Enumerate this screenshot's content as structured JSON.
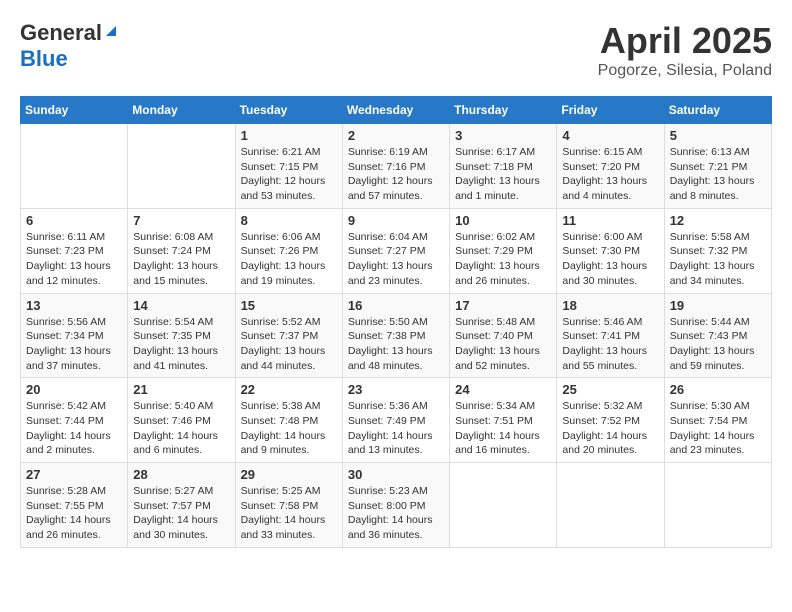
{
  "header": {
    "logo_general": "General",
    "logo_blue": "Blue",
    "title": "April 2025",
    "subtitle": "Pogorze, Silesia, Poland"
  },
  "calendar": {
    "days_of_week": [
      "Sunday",
      "Monday",
      "Tuesday",
      "Wednesday",
      "Thursday",
      "Friday",
      "Saturday"
    ],
    "weeks": [
      [
        {
          "day": "",
          "info": ""
        },
        {
          "day": "",
          "info": ""
        },
        {
          "day": "1",
          "info": "Sunrise: 6:21 AM\nSunset: 7:15 PM\nDaylight: 12 hours and 53 minutes."
        },
        {
          "day": "2",
          "info": "Sunrise: 6:19 AM\nSunset: 7:16 PM\nDaylight: 12 hours and 57 minutes."
        },
        {
          "day": "3",
          "info": "Sunrise: 6:17 AM\nSunset: 7:18 PM\nDaylight: 13 hours and 1 minute."
        },
        {
          "day": "4",
          "info": "Sunrise: 6:15 AM\nSunset: 7:20 PM\nDaylight: 13 hours and 4 minutes."
        },
        {
          "day": "5",
          "info": "Sunrise: 6:13 AM\nSunset: 7:21 PM\nDaylight: 13 hours and 8 minutes."
        }
      ],
      [
        {
          "day": "6",
          "info": "Sunrise: 6:11 AM\nSunset: 7:23 PM\nDaylight: 13 hours and 12 minutes."
        },
        {
          "day": "7",
          "info": "Sunrise: 6:08 AM\nSunset: 7:24 PM\nDaylight: 13 hours and 15 minutes."
        },
        {
          "day": "8",
          "info": "Sunrise: 6:06 AM\nSunset: 7:26 PM\nDaylight: 13 hours and 19 minutes."
        },
        {
          "day": "9",
          "info": "Sunrise: 6:04 AM\nSunset: 7:27 PM\nDaylight: 13 hours and 23 minutes."
        },
        {
          "day": "10",
          "info": "Sunrise: 6:02 AM\nSunset: 7:29 PM\nDaylight: 13 hours and 26 minutes."
        },
        {
          "day": "11",
          "info": "Sunrise: 6:00 AM\nSunset: 7:30 PM\nDaylight: 13 hours and 30 minutes."
        },
        {
          "day": "12",
          "info": "Sunrise: 5:58 AM\nSunset: 7:32 PM\nDaylight: 13 hours and 34 minutes."
        }
      ],
      [
        {
          "day": "13",
          "info": "Sunrise: 5:56 AM\nSunset: 7:34 PM\nDaylight: 13 hours and 37 minutes."
        },
        {
          "day": "14",
          "info": "Sunrise: 5:54 AM\nSunset: 7:35 PM\nDaylight: 13 hours and 41 minutes."
        },
        {
          "day": "15",
          "info": "Sunrise: 5:52 AM\nSunset: 7:37 PM\nDaylight: 13 hours and 44 minutes."
        },
        {
          "day": "16",
          "info": "Sunrise: 5:50 AM\nSunset: 7:38 PM\nDaylight: 13 hours and 48 minutes."
        },
        {
          "day": "17",
          "info": "Sunrise: 5:48 AM\nSunset: 7:40 PM\nDaylight: 13 hours and 52 minutes."
        },
        {
          "day": "18",
          "info": "Sunrise: 5:46 AM\nSunset: 7:41 PM\nDaylight: 13 hours and 55 minutes."
        },
        {
          "day": "19",
          "info": "Sunrise: 5:44 AM\nSunset: 7:43 PM\nDaylight: 13 hours and 59 minutes."
        }
      ],
      [
        {
          "day": "20",
          "info": "Sunrise: 5:42 AM\nSunset: 7:44 PM\nDaylight: 14 hours and 2 minutes."
        },
        {
          "day": "21",
          "info": "Sunrise: 5:40 AM\nSunset: 7:46 PM\nDaylight: 14 hours and 6 minutes."
        },
        {
          "day": "22",
          "info": "Sunrise: 5:38 AM\nSunset: 7:48 PM\nDaylight: 14 hours and 9 minutes."
        },
        {
          "day": "23",
          "info": "Sunrise: 5:36 AM\nSunset: 7:49 PM\nDaylight: 14 hours and 13 minutes."
        },
        {
          "day": "24",
          "info": "Sunrise: 5:34 AM\nSunset: 7:51 PM\nDaylight: 14 hours and 16 minutes."
        },
        {
          "day": "25",
          "info": "Sunrise: 5:32 AM\nSunset: 7:52 PM\nDaylight: 14 hours and 20 minutes."
        },
        {
          "day": "26",
          "info": "Sunrise: 5:30 AM\nSunset: 7:54 PM\nDaylight: 14 hours and 23 minutes."
        }
      ],
      [
        {
          "day": "27",
          "info": "Sunrise: 5:28 AM\nSunset: 7:55 PM\nDaylight: 14 hours and 26 minutes."
        },
        {
          "day": "28",
          "info": "Sunrise: 5:27 AM\nSunset: 7:57 PM\nDaylight: 14 hours and 30 minutes."
        },
        {
          "day": "29",
          "info": "Sunrise: 5:25 AM\nSunset: 7:58 PM\nDaylight: 14 hours and 33 minutes."
        },
        {
          "day": "30",
          "info": "Sunrise: 5:23 AM\nSunset: 8:00 PM\nDaylight: 14 hours and 36 minutes."
        },
        {
          "day": "",
          "info": ""
        },
        {
          "day": "",
          "info": ""
        },
        {
          "day": "",
          "info": ""
        }
      ]
    ]
  }
}
